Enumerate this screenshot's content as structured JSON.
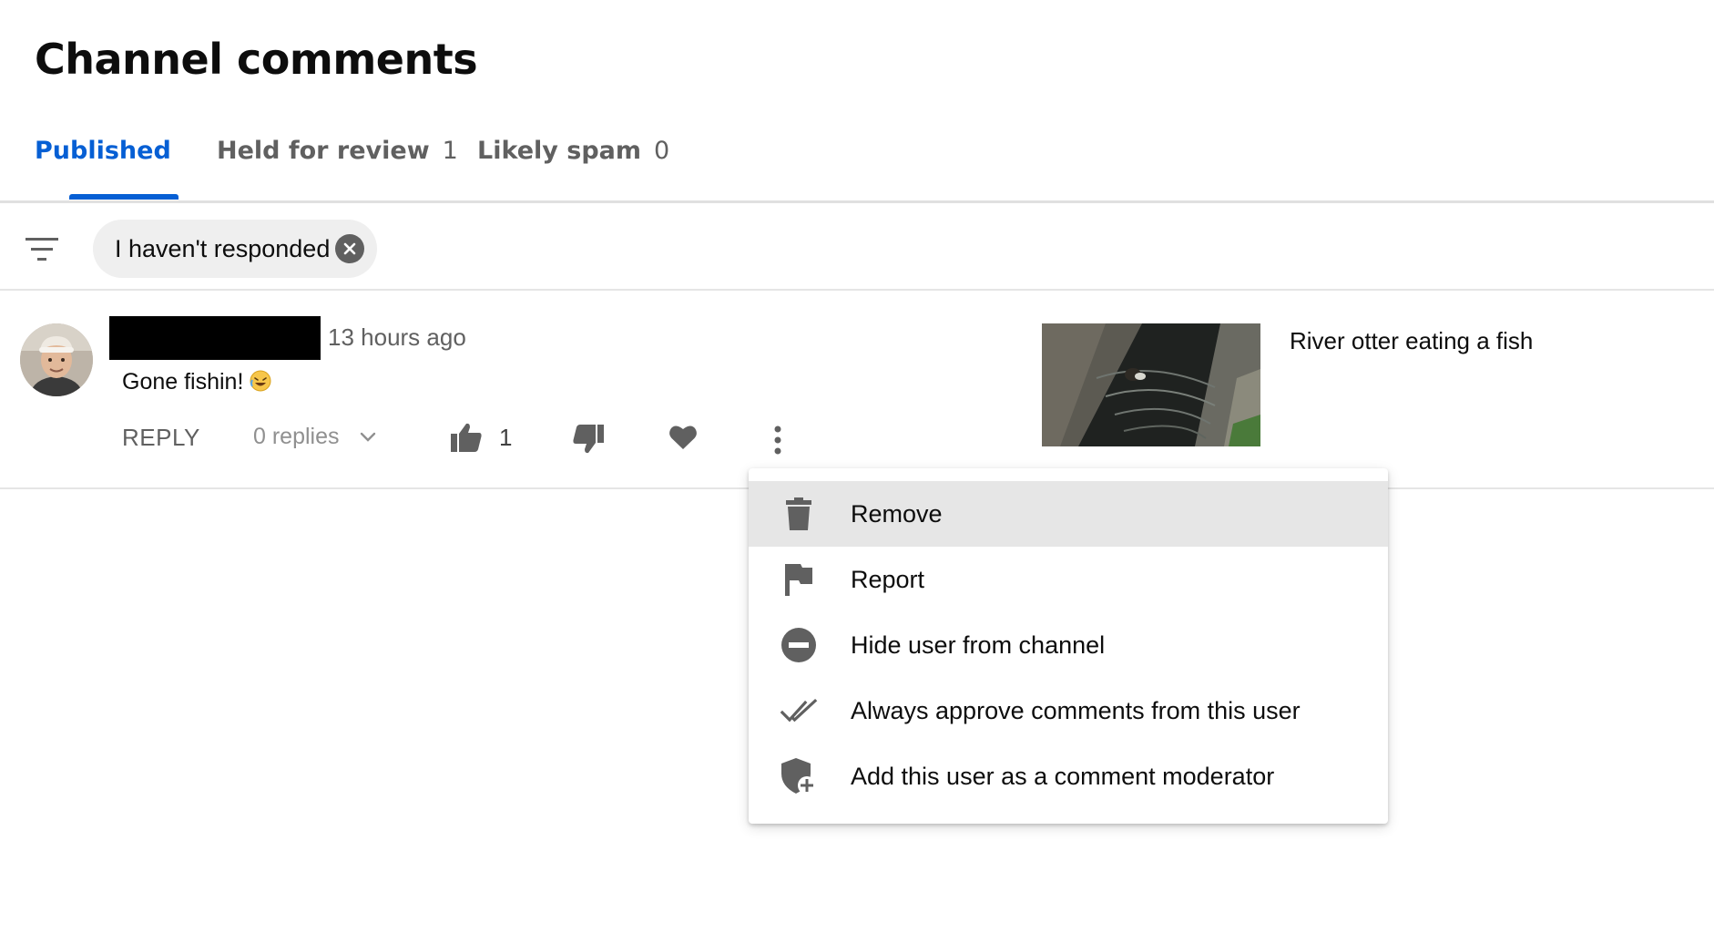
{
  "header": {
    "title": "Channel comments"
  },
  "tabs": [
    {
      "label": "Published",
      "count": ""
    },
    {
      "label": "Held for review",
      "count": "1"
    },
    {
      "label": "Likely spam",
      "count": "0"
    }
  ],
  "filter": {
    "icon": "filter-icon",
    "chip_label": "I haven't responded"
  },
  "comment": {
    "timestamp": "13 hours ago",
    "text": "Gone fishin!",
    "reply_label": "REPLY",
    "replies_label": "0 replies",
    "like_count": "1"
  },
  "video": {
    "title": "River otter eating a fish"
  },
  "menu": {
    "items": [
      {
        "label": "Remove",
        "icon": "trash-icon"
      },
      {
        "label": "Report",
        "icon": "flag-icon"
      },
      {
        "label": "Hide user from channel",
        "icon": "minus-circle-icon"
      },
      {
        "label": "Always approve comments from this user",
        "icon": "double-check-icon"
      },
      {
        "label": "Add this user as a comment moderator",
        "icon": "shield-add-icon"
      }
    ]
  },
  "colors": {
    "accent": "#065fd4",
    "icon_gray": "#606060",
    "menu_hover": "#e6e6e6"
  }
}
